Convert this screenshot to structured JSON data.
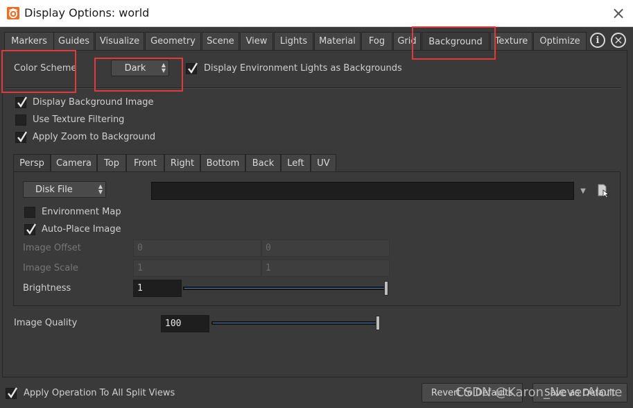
{
  "window": {
    "title": "Display Options:  world",
    "close_symbol": "×"
  },
  "tabs": [
    "Markers",
    "Guides",
    "Visualize",
    "Geometry",
    "Scene",
    "View",
    "Lights",
    "Material",
    "Fog",
    "Grid",
    "Background",
    "Texture",
    "Optimize"
  ],
  "active_tab": "Background",
  "help_symbol": "i",
  "color_scheme": {
    "label": "Color Scheme",
    "value": "Dark"
  },
  "display_env_lights": {
    "label": "Display Environment Lights as Backgrounds",
    "checked": true
  },
  "display_bg_image": {
    "label": "Display Background Image",
    "checked": true
  },
  "use_texture_filtering": {
    "label": "Use Texture Filtering",
    "checked": false
  },
  "apply_zoom": {
    "label": "Apply Zoom to Background",
    "checked": true
  },
  "view_tabs": [
    "Persp",
    "Camera",
    "Top",
    "Front",
    "Right",
    "Bottom",
    "Back",
    "Left",
    "UV"
  ],
  "active_view_tab": "Persp",
  "source": {
    "value": "Disk File"
  },
  "file_path": "",
  "environment_map": {
    "label": "Environment Map",
    "checked": false
  },
  "auto_place": {
    "label": "Auto-Place Image",
    "checked": true
  },
  "image_offset": {
    "label": "Image Offset",
    "x": "0",
    "y": "0"
  },
  "image_scale": {
    "label": "Image Scale",
    "x": "1",
    "y": "1"
  },
  "brightness": {
    "label": "Brightness",
    "value": "1",
    "level": 1.0
  },
  "image_quality": {
    "label": "Image Quality",
    "value": "100",
    "level": 1.0
  },
  "apply_all_split": {
    "label": "Apply Operation To All Split Views",
    "checked": true
  },
  "buttons": {
    "revert": "Revert to Defaults",
    "save": "Save as Default"
  },
  "watermark": "CSDN @Karon_NeverAlone",
  "colors": {
    "highlight_box": "#e23a3a",
    "slider_fill": "#3e6fb8",
    "panel_bg": "#3a3a3a"
  }
}
